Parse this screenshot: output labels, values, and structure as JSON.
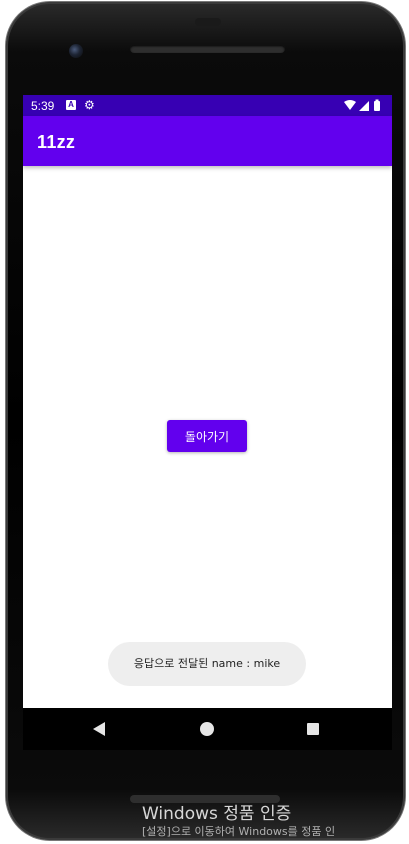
{
  "status_bar": {
    "time": "5:39",
    "notification_icons": [
      "a-square-icon",
      "gear-icon"
    ],
    "system_icons": [
      "wifi-icon",
      "signal-icon",
      "battery-icon"
    ]
  },
  "app_bar": {
    "title": "11zz"
  },
  "main": {
    "back_button_label": "돌아가기"
  },
  "toast": {
    "message": "응답으로 전달된 name : mike"
  },
  "nav_bar": {
    "icons": [
      "back-icon",
      "home-icon",
      "recents-icon"
    ]
  },
  "windows_watermark": {
    "title": "Windows 정품 인증",
    "subtitle": "[설정]으로 이동하여 Windows를 정품 인"
  },
  "colors": {
    "status_bar": "#3700b3",
    "primary": "#6200ee",
    "toast_bg": "#eeeeee"
  }
}
